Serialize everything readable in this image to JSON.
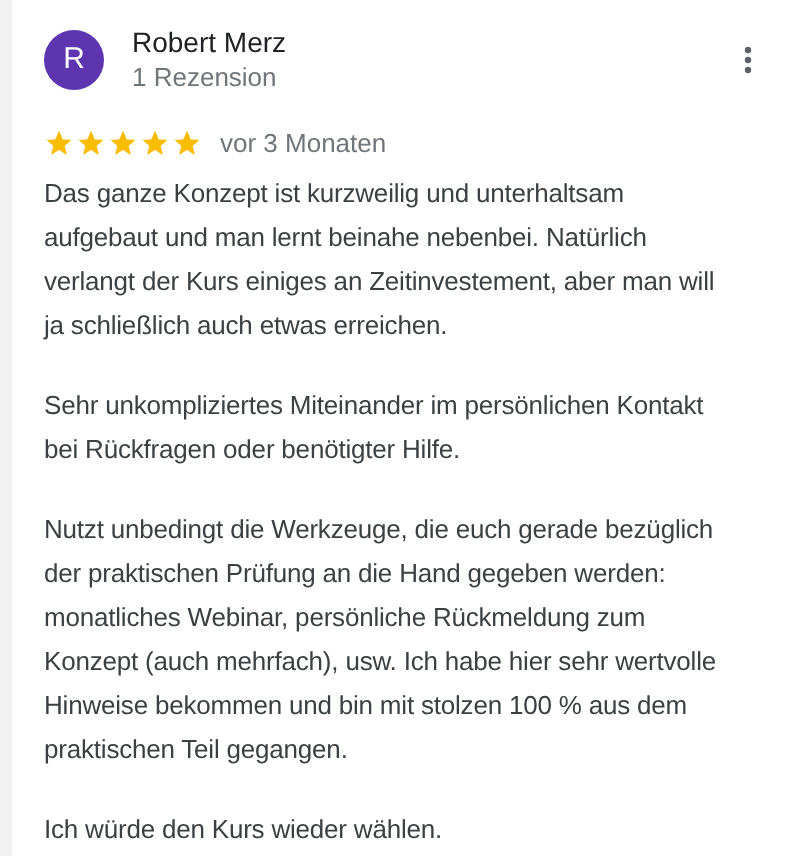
{
  "reviewer": {
    "initial": "R",
    "name": "Robert Merz",
    "review_count": "1 Rezension"
  },
  "rating": {
    "stars": 5,
    "time": "vor 3 Monaten"
  },
  "paragraphs": [
    "Das ganze Konzept ist kurzweilig und unterhaltsam aufgebaut und man lernt beinahe nebenbei. Natürlich verlangt der Kurs einiges an Zeitinvestement, aber man will ja schließlich auch etwas erreichen.",
    "Sehr unkompliziertes Miteinander im persönlichen Kontakt bei Rückfragen oder benötigter Hilfe.",
    "Nutzt unbedingt die Werkzeuge, die euch gerade bezüglich der praktischen Prüfung an die Hand gegeben werden: monatliches Webinar, persönliche Rückmeldung zum Konzept (auch mehrfach), usw. Ich habe hier sehr wertvolle Hinweise bekommen und bin mit stolzen 100 % aus dem praktischen Teil gegangen.",
    "Ich würde den Kurs wieder wählen."
  ]
}
